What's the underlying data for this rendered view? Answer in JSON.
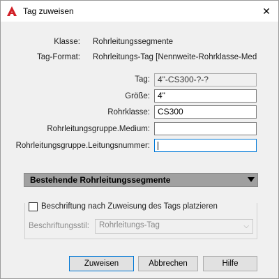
{
  "window": {
    "title": "Tag zuweisen",
    "icon": "autocad-logo-icon",
    "close_glyph": "✕"
  },
  "info": {
    "klasse_label": "Klasse:",
    "klasse_value": "Rohrleitungssegmente",
    "tagformat_label": "Tag-Format:",
    "tagformat_value": "Rohrleitungs-Tag  [Nennweite-Rohrklasse-Medi..."
  },
  "fields": {
    "tag_label": "Tag:",
    "tag_value": "4\"-CS300-?-?",
    "groesse_label": "Größe:",
    "groesse_value": "4\"",
    "rohrklasse_label": "Rohrklasse:",
    "rohrklasse_value": "CS300",
    "medium_label": "Rohrleitungsgruppe.Medium:",
    "medium_value": "",
    "leitungsnummer_label": "Rohrleitungsgruppe.Leitungsnummer:",
    "leitungsnummer_value": ""
  },
  "section": {
    "title": "Bestehende Rohrleitungssegmente",
    "toggle_icon": "triangle-down-icon"
  },
  "annotation": {
    "checkbox_label": "Beschriftung nach Zuweisung des Tags platzieren",
    "checked": false,
    "style_label": "Beschriftungsstil:",
    "style_value": "Rohrleitungs-Tag"
  },
  "buttons": {
    "assign": "Zuweisen",
    "cancel": "Abbrechen",
    "help": "Hilfe"
  },
  "colors": {
    "accent": "#0078d7",
    "logo_red": "#d11f26",
    "section_bar": "#a0a0a0"
  }
}
